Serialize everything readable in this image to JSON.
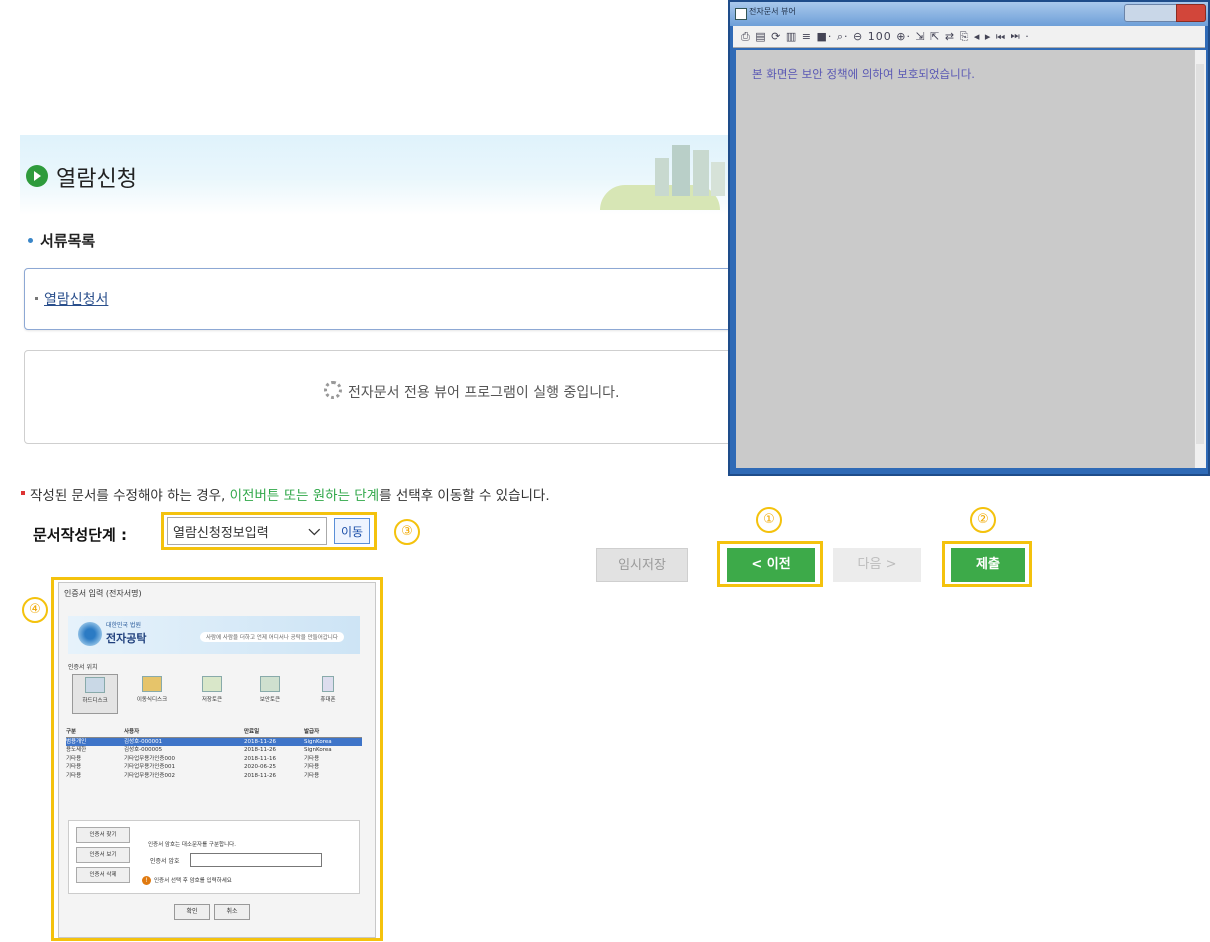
{
  "page": {
    "title": "열람신청",
    "section_title": "서류목록",
    "doc_link": "열람신청서",
    "viewer_message": "전자문서 전용 뷰어 프로그램이 실행 중입니다.",
    "notice": {
      "pre": "작성된 문서를 수정해야 하는 경우, ",
      "highlight": "이전버튼 또는 원하는 단계",
      "post": "를 선택후 이동할 수 있습니다."
    },
    "step_label": "문서작성단계 :",
    "step_select_value": "열람신청정보입력",
    "go_button": "이동"
  },
  "buttons": {
    "temp_save": "임시저장",
    "prev": "< 이전",
    "next": "다음 >",
    "submit": "제출"
  },
  "markers": [
    "①",
    "②",
    "③",
    "④"
  ],
  "viewer_window": {
    "title": "전자문서 뷰어",
    "toolbar": "⎙ ▤ ⟳ ▥ ≡ ■· ⌕· ⊖ 100 ⊕· ⇲ ⇱ ⇄ ⎘ ◂ ▸ ⏮ ⏭ ·",
    "message": "본 화면은 보안 정책에 의하여 보호되었습니다."
  },
  "cert_dialog": {
    "title": "인증서 입력 (전자서명)",
    "brand_small": "대한민국 법원",
    "brand": "전자공탁",
    "tagline": "사람에 사람을 더하고 언제 어디서나 공탁을 만들어갑니다",
    "location_label": "인증서 위치",
    "locations": [
      "하드디스크",
      "이동식디스크",
      "저장토큰",
      "보안토큰",
      "휴대폰"
    ],
    "table": {
      "headers": [
        "구분",
        "사용자",
        "만료일",
        "발급자"
      ],
      "rows": [
        [
          "범용개인",
          "김성호-000001",
          "2018-11-26",
          "SignKorea"
        ],
        [
          "용도제한",
          "김성호-000005",
          "2018-11-26",
          "SignKorea"
        ],
        [
          "기타용",
          "기타업무용가인증000",
          "2018-11-16",
          "기타용"
        ],
        [
          "기타용",
          "기타업무용가인증001",
          "2020-06-25",
          "기타용"
        ],
        [
          "기타용",
          "기타업무용가인증002",
          "2018-11-26",
          "기타용"
        ]
      ]
    },
    "side_buttons": [
      "인증서 찾기",
      "인증서 보기",
      "인증서 삭제"
    ],
    "password_hint": "인증서 암호는 대소문자를 구분합니다.",
    "password_label": "인증서 암호",
    "warning_text": "인증서 선택 후 암호를 입력하세요",
    "ok": "확인",
    "cancel": "취소"
  },
  "colors": {
    "accent_green": "#3daa49",
    "highlight_yellow": "#f4c20d",
    "viewer_gray": "#cacaca"
  }
}
